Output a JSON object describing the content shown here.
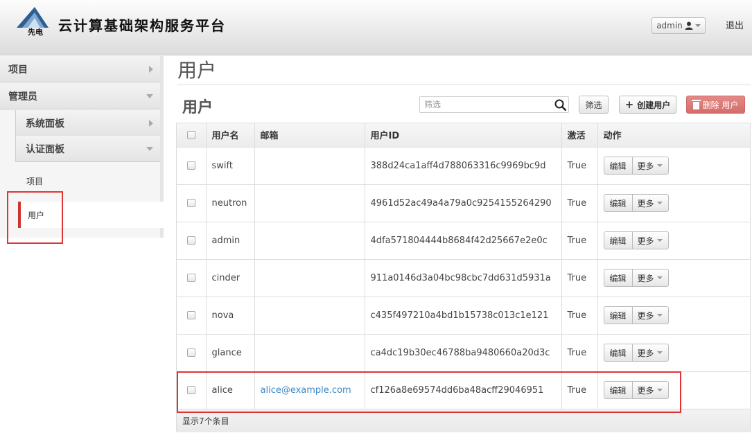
{
  "header": {
    "logo_text": "先电",
    "brand": "云计算基础架构服务平台",
    "user_menu_label": "admin",
    "signout_label": "退出"
  },
  "sidebar": {
    "project_label": "项目",
    "admin_label": "管理员",
    "system_panel_label": "系统面板",
    "identity_panel_label": "认证面板",
    "identity_items": [
      {
        "label": "项目"
      },
      {
        "label": "用户"
      }
    ]
  },
  "page": {
    "title": "用户",
    "table_title": "用户"
  },
  "toolbar": {
    "filter_placeholder": "筛选",
    "filter_button": "筛选",
    "create_button": "创建用户",
    "delete_button": "删除 用户"
  },
  "table": {
    "columns": [
      "用户名",
      "邮箱",
      "用户ID",
      "激活",
      "动作"
    ],
    "rows": [
      {
        "name": "swift",
        "email": "",
        "id": "388d24ca1aff4d788063316c9969bc9d",
        "enabled": "True"
      },
      {
        "name": "neutron",
        "email": "",
        "id": "4961d52ac49a4a79a0c9254155264290",
        "enabled": "True"
      },
      {
        "name": "admin",
        "email": "",
        "id": "4dfa571804444b8684f42d25667e2e0c",
        "enabled": "True"
      },
      {
        "name": "cinder",
        "email": "",
        "id": "911a0146d3a04bc98cbc7dd631d5931a",
        "enabled": "True"
      },
      {
        "name": "nova",
        "email": "",
        "id": "c435f497210a4bd1b15738c013c1e121",
        "enabled": "True"
      },
      {
        "name": "glance",
        "email": "",
        "id": "ca4dc19b30ec46788ba9480660a20d3c",
        "enabled": "True"
      },
      {
        "name": "alice",
        "email": "alice@example.com",
        "id": "cf126a8e69574dd6ba48acff29046951",
        "enabled": "True"
      }
    ],
    "edit_label": "编辑",
    "more_label": "更多",
    "footer": "显示7个条目"
  },
  "colors": {
    "accent_red": "#d2322d",
    "link_blue": "#3a87c8",
    "highlight_box": "#e03333"
  }
}
